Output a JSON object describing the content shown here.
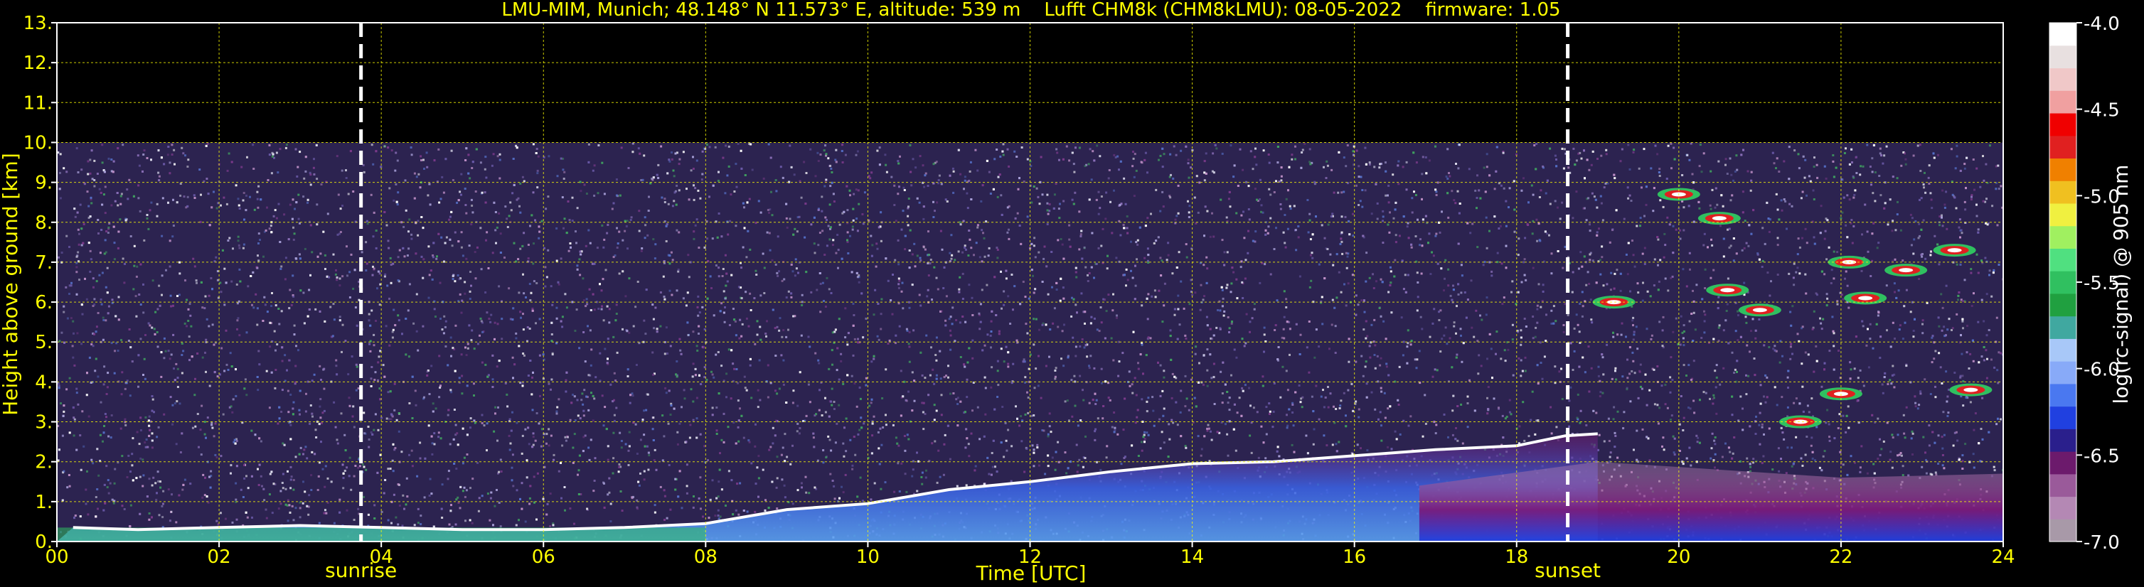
{
  "chart_data": {
    "type": "heatmap",
    "title": "LMU-MIM, Munich; 48.148° N 11.573° E, altitude: 539 m    Lufft CHM8k (CHM8kLMU): 08-05-2022    firmware: 1.05",
    "xlabel": "Time [UTC]",
    "ylabel": "Height above ground [km]",
    "xlim": [
      0,
      24
    ],
    "ylim": [
      0,
      13
    ],
    "x_ticks": [
      0,
      2,
      4,
      6,
      8,
      10,
      12,
      14,
      16,
      18,
      20,
      22,
      24
    ],
    "x_tick_labels": [
      "00",
      "02",
      "04",
      "06",
      "08",
      "10",
      "12",
      "14",
      "16",
      "18",
      "20",
      "22",
      "24"
    ],
    "y_ticks": [
      0,
      1,
      2,
      3,
      4,
      5,
      6,
      7,
      8,
      9,
      10,
      11,
      12,
      13
    ],
    "y_tick_labels": [
      "0.",
      "1.",
      "2.",
      "3.",
      "4.",
      "5.",
      "6.",
      "7.",
      "8.",
      "9.",
      "10.",
      "11.",
      "12.",
      "13."
    ],
    "grid": true,
    "markers": [
      {
        "label": "sunrise",
        "x": 3.75
      },
      {
        "label": "sunset",
        "x": 18.63
      }
    ],
    "colorbar": {
      "label": "log(rc-signal) @ 905 nm",
      "range": [
        -7.0,
        -4.0
      ],
      "ticks": [
        -4.0,
        -4.5,
        -5.0,
        -5.5,
        -6.0,
        -6.5,
        -7.0
      ],
      "tick_labels": [
        "-4.0",
        "-4.5",
        "-5.0",
        "-5.5",
        "-6.0",
        "-6.5",
        "-7.0"
      ],
      "colors": [
        "#a899a8",
        "#b488b4",
        "#9a5a9a",
        "#6c1a6c",
        "#2a1f8c",
        "#2040e0",
        "#4a78f0",
        "#88aaf8",
        "#a8c8f8",
        "#40a8a0",
        "#20a040",
        "#30c060",
        "#50e080",
        "#a0f060",
        "#f0f040",
        "#f0c020",
        "#f08000",
        "#e02020",
        "#f00000",
        "#f0a0a0",
        "#f0c8c8",
        "#e8e0e0",
        "#ffffff"
      ]
    },
    "data_max_height_km": 10,
    "cloud_base": [
      {
        "x": 0.2,
        "y": 0.35
      },
      {
        "x": 1.0,
        "y": 0.3
      },
      {
        "x": 2.0,
        "y": 0.35
      },
      {
        "x": 3.0,
        "y": 0.4
      },
      {
        "x": 4.0,
        "y": 0.35
      },
      {
        "x": 5.0,
        "y": 0.3
      },
      {
        "x": 6.0,
        "y": 0.3
      },
      {
        "x": 7.0,
        "y": 0.35
      },
      {
        "x": 8.0,
        "y": 0.45
      },
      {
        "x": 9.0,
        "y": 0.8
      },
      {
        "x": 10.0,
        "y": 0.95
      },
      {
        "x": 11.0,
        "y": 1.3
      },
      {
        "x": 12.0,
        "y": 1.5
      },
      {
        "x": 13.0,
        "y": 1.75
      },
      {
        "x": 14.0,
        "y": 1.95
      },
      {
        "x": 15.0,
        "y": 2.0
      },
      {
        "x": 16.0,
        "y": 2.15
      },
      {
        "x": 17.0,
        "y": 2.3
      },
      {
        "x": 18.0,
        "y": 2.4
      },
      {
        "x": 18.6,
        "y": 2.65
      },
      {
        "x": 19.0,
        "y": 2.7
      }
    ],
    "clouds": [
      {
        "x": 19.2,
        "y": 6.0
      },
      {
        "x": 20.0,
        "y": 8.7
      },
      {
        "x": 20.5,
        "y": 8.1
      },
      {
        "x": 20.6,
        "y": 6.3
      },
      {
        "x": 21.0,
        "y": 5.8
      },
      {
        "x": 22.1,
        "y": 7.0
      },
      {
        "x": 22.3,
        "y": 6.1
      },
      {
        "x": 22.8,
        "y": 6.8
      },
      {
        "x": 23.4,
        "y": 7.3
      },
      {
        "x": 23.6,
        "y": 3.8
      },
      {
        "x": 21.5,
        "y": 3.0
      },
      {
        "x": 22.0,
        "y": 3.7
      }
    ]
  }
}
